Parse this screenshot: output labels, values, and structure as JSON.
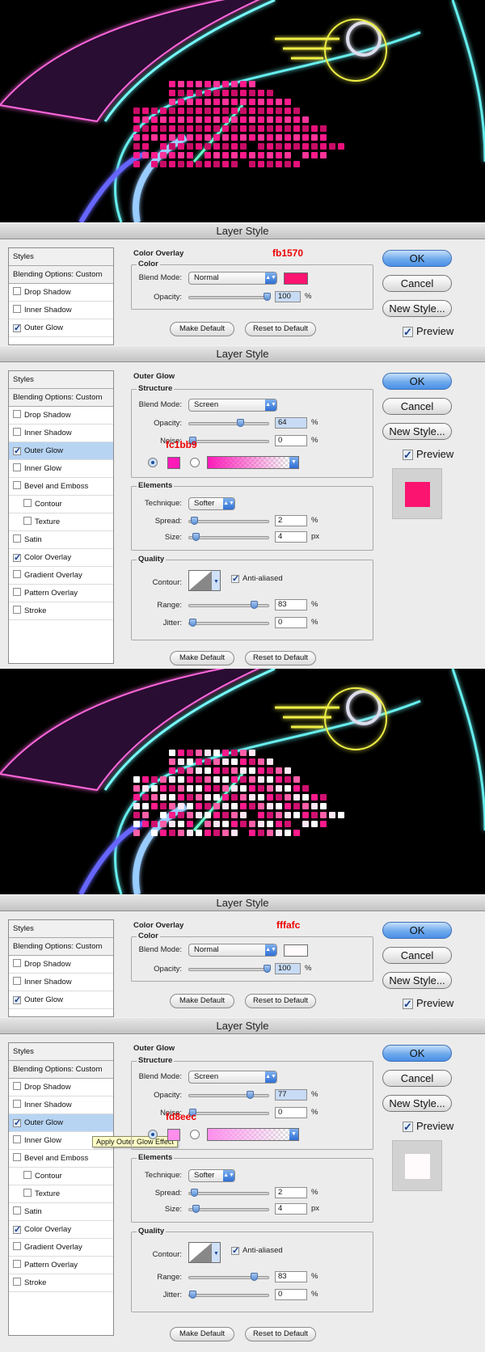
{
  "dialog_title": "Layer Style",
  "buttons": {
    "ok": "OK",
    "cancel": "Cancel",
    "new_style": "New Style...",
    "preview": "Preview",
    "make_default": "Make Default",
    "reset_default": "Reset to Default"
  },
  "style_list": {
    "header": "Styles",
    "blending": "Blending Options: Custom",
    "drop_shadow": "Drop Shadow",
    "inner_shadow": "Inner Shadow",
    "outer_glow": "Outer Glow",
    "inner_glow": "Inner Glow",
    "bevel": "Bevel and Emboss",
    "contour": "Contour",
    "texture": "Texture",
    "satin": "Satin",
    "color_overlay": "Color Overlay",
    "gradient_overlay": "Gradient Overlay",
    "pattern_overlay": "Pattern Overlay",
    "stroke": "Stroke"
  },
  "labels": {
    "color_overlay": "Color Overlay",
    "color": "Color",
    "outer_glow": "Outer Glow",
    "structure": "Structure",
    "elements": "Elements",
    "quality": "Quality",
    "blend_mode": "Blend Mode:",
    "opacity": "Opacity:",
    "noise": "Noise:",
    "technique": "Technique:",
    "spread": "Spread:",
    "size": "Size:",
    "contour": "Contour:",
    "anti_aliased": "Anti-aliased",
    "range": "Range:",
    "jitter": "Jitter:",
    "percent": "%",
    "px": "px"
  },
  "dialog1": {
    "blend_mode": "Normal",
    "opacity": "100",
    "hex": "fb1570",
    "swatch_color": "#fb1570"
  },
  "dialog2": {
    "blend_mode": "Screen",
    "opacity": "64",
    "noise": "0",
    "hex": "fc1bb9",
    "swatch_color": "#fc1bb9",
    "technique": "Softer",
    "spread": "2",
    "size": "4",
    "range": "83",
    "jitter": "0",
    "preview_color": "#fb1570"
  },
  "dialog3": {
    "blend_mode": "Normal",
    "opacity": "100",
    "hex": "fffafc",
    "swatch_color": "#fffafc"
  },
  "dialog4": {
    "blend_mode": "Screen",
    "opacity": "77",
    "noise": "0",
    "hex": "fd8eec",
    "swatch_color": "#fd8eec",
    "technique": "Softer",
    "spread": "2",
    "size": "4",
    "range": "83",
    "jitter": "0",
    "preview_color": "#fffafc",
    "tooltip": "Apply Outer Glow Effect"
  }
}
